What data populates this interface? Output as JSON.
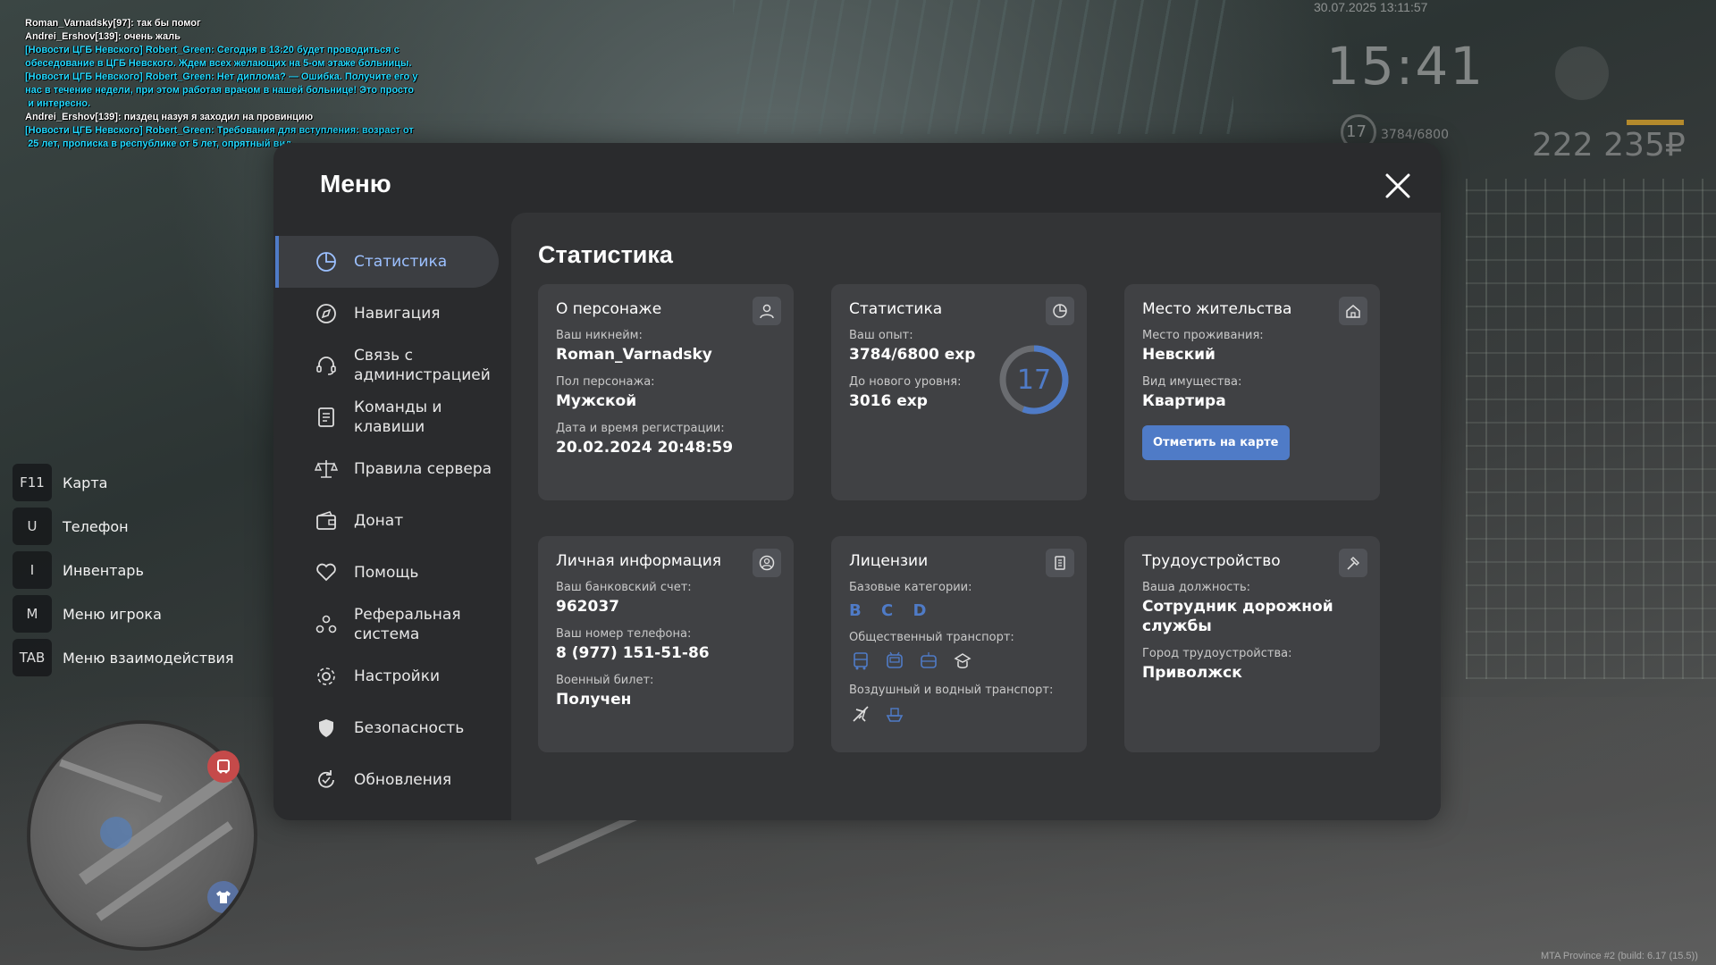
{
  "chat": [
    {
      "text": "Roman_Varnadsky[97]: так бы помог",
      "color": "white"
    },
    {
      "text": "Andrei_Ershov[139]: очень жаль",
      "color": "white"
    },
    {
      "text": "[Новости ЦГБ Невского] Robert_Green: Сегодня в 13:20 будет проводиться с\nобеседование в ЦГБ Невского. Ждем всех желающих на 5-ом этаже больницы.",
      "color": "cyan"
    },
    {
      "text": "[Новости ЦГБ Невского] Robert_Green: Нет диплома? — Ошибка. Получите его у\nнас в течение недели, при этом работая врачом в нашей больнице! Это просто\n и интересно.",
      "color": "cyan"
    },
    {
      "text": "Andrei_Ershov[139]: пиздец назуя я заходил на провинцию",
      "color": "white"
    },
    {
      "text": "[Новости ЦГБ Невского] Robert_Green: Требования для вступления: возраст от\n 25 лет, прописка в республике от 5 лет, опрятный вид.",
      "color": "cyan"
    }
  ],
  "hud": {
    "datetime": "30.07.2025 13:11:57",
    "time": "15:41",
    "level": "17",
    "exp": "3784/6800",
    "money": "222 235₽",
    "fist_icon": "fist-icon"
  },
  "hotkeys": [
    {
      "key": "F11",
      "label": "Карта"
    },
    {
      "key": "U",
      "label": "Телефон"
    },
    {
      "key": "I",
      "label": "Инвентарь"
    },
    {
      "key": "M",
      "label": "Меню игрока"
    },
    {
      "key": "TAB",
      "label": "Меню взаимодействия"
    }
  ],
  "menu": {
    "title": "Меню",
    "close_icon": "close-icon",
    "items": [
      {
        "label": "Статистика",
        "icon": "pie-chart-icon",
        "active": true
      },
      {
        "label": "Навигация",
        "icon": "compass-icon"
      },
      {
        "label": "Связь с\nадминистрацией",
        "icon": "headset-icon"
      },
      {
        "label": "Команды и\nклавиши",
        "icon": "document-icon"
      },
      {
        "label": "Правила сервера",
        "icon": "scales-icon"
      },
      {
        "label": "Донат",
        "icon": "wallet-icon"
      },
      {
        "label": "Помощь",
        "icon": "heart-hand-icon"
      },
      {
        "label": "Реферальная\nсистема",
        "icon": "people-icon"
      },
      {
        "label": "Настройки",
        "icon": "gear-icon"
      },
      {
        "label": "Безопасность",
        "icon": "shield-icon"
      },
      {
        "label": "Обновления",
        "icon": "refresh-icon"
      }
    ]
  },
  "content": {
    "title": "Статистика",
    "character": {
      "title": "О персонаже",
      "nickname_label": "Ваш никнейм:",
      "nickname": "Roman_Varnadsky",
      "gender_label": "Пол персонажа:",
      "gender": "Мужской",
      "reg_label": "Дата и время регистрации:",
      "reg": "20.02.2024 20:48:59"
    },
    "stats": {
      "title": "Статистика",
      "exp_label": "Ваш опыт:",
      "exp": "3784/6800 exp",
      "next_label": "До нового уровня:",
      "next": "3016 exp",
      "level": "17",
      "progress": 0.556,
      "accent": "#4f7bc7"
    },
    "residence": {
      "title": "Место жительства",
      "place_label": "Место проживания:",
      "place": "Невский",
      "type_label": "Вид имущества:",
      "type": "Квартира",
      "button": "Отметить на карте"
    },
    "personal": {
      "title": "Личная информация",
      "bank_label": "Ваш банковский счет:",
      "bank": "962037",
      "phone_label": "Ваш номер телефона:",
      "phone": "8 (977) 151-51-86",
      "military_label": "Военный билет:",
      "military": "Получен"
    },
    "licenses": {
      "title": "Лицензии",
      "base_label": "Базовые категории:",
      "base": "B C D",
      "public_label": "Общественный транспорт:",
      "air_label": "Воздушный и водный транспорт:"
    },
    "employment": {
      "title": "Трудоустройство",
      "position_label": "Ваша должность:",
      "position": "Сотрудник дорожной службы",
      "city_label": "Город трудоустройства:",
      "city": "Приволжск"
    }
  },
  "build": "MTA Province #2 (build: 6.17 (15.5))"
}
